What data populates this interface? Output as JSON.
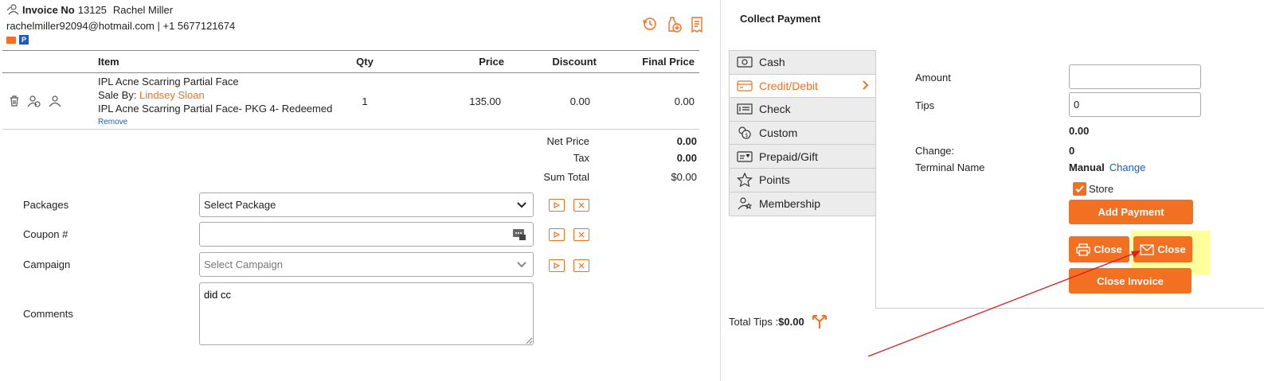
{
  "header": {
    "invoice_label": "Invoice No",
    "invoice_number": "13125",
    "customer_name": "Rachel Miller",
    "contact": "rachelmiller92094@hotmail.com | +1 5677121674",
    "badge_p": "P"
  },
  "items_table": {
    "headers": {
      "item": "Item",
      "qty": "Qty",
      "price": "Price",
      "discount": "Discount",
      "final_price": "Final Price"
    },
    "rows": [
      {
        "name": "IPL Acne Scarring Partial Face",
        "sale_by_label": "Sale By: ",
        "sale_by": "Lindsey Sloan",
        "package_note": "IPL Acne Scarring Partial Face- PKG 4- Redeemed",
        "remove": "Remove",
        "qty": "1",
        "price": "135.00",
        "discount": "0.00",
        "final_price": "0.00"
      }
    ]
  },
  "totals": {
    "net_price_label": "Net Price",
    "net_price": "0.00",
    "tax_label": "Tax",
    "tax": "0.00",
    "sum_total_label": "Sum Total",
    "sum_total": "$0.00"
  },
  "form": {
    "packages_label": "Packages",
    "packages_value": "Select Package",
    "coupon_label": "Coupon #",
    "coupon_value": "",
    "campaign_label": "Campaign",
    "campaign_value": "Select Campaign",
    "comments_label": "Comments",
    "comments_value": "did cc"
  },
  "payment": {
    "title": "Collect Payment",
    "tabs": [
      "Cash",
      "Credit/Debit",
      "Check",
      "Custom",
      "Prepaid/Gift",
      "Points",
      "Membership"
    ],
    "active_tab": "Credit/Debit",
    "amount_label": "Amount",
    "amount_value": "",
    "tips_label": "Tips",
    "tips_value": "0",
    "subtotal": "0.00",
    "change_label": "Change:",
    "change_value": "0",
    "terminal_label": "Terminal Name",
    "terminal_value": "Manual",
    "terminal_change": "Change",
    "store_label": "Store",
    "add_payment": "Add Payment",
    "close_print": "Close",
    "close_email": "Close",
    "close_invoice": "Close Invoice",
    "total_tips_label": "Total Tips :",
    "total_tips_value": "$0.00"
  },
  "colors": {
    "accent": "#f36f21",
    "link": "#1d5bbf",
    "highlight": "#ffff9c",
    "annotation_arrow": "#e01b1b"
  },
  "icons": [
    "customer-icon",
    "history-icon",
    "add-product-icon",
    "receipt-icon",
    "trash-icon",
    "assign-staff-icon",
    "staff-icon",
    "dropdown-chevron-icon",
    "coupon-icon",
    "apply-icon",
    "clear-icon",
    "cash-icon",
    "card-icon",
    "check-icon",
    "custom-icon",
    "gift-card-icon",
    "star-icon",
    "membership-icon",
    "printer-icon",
    "email-icon",
    "split-tips-icon"
  ]
}
